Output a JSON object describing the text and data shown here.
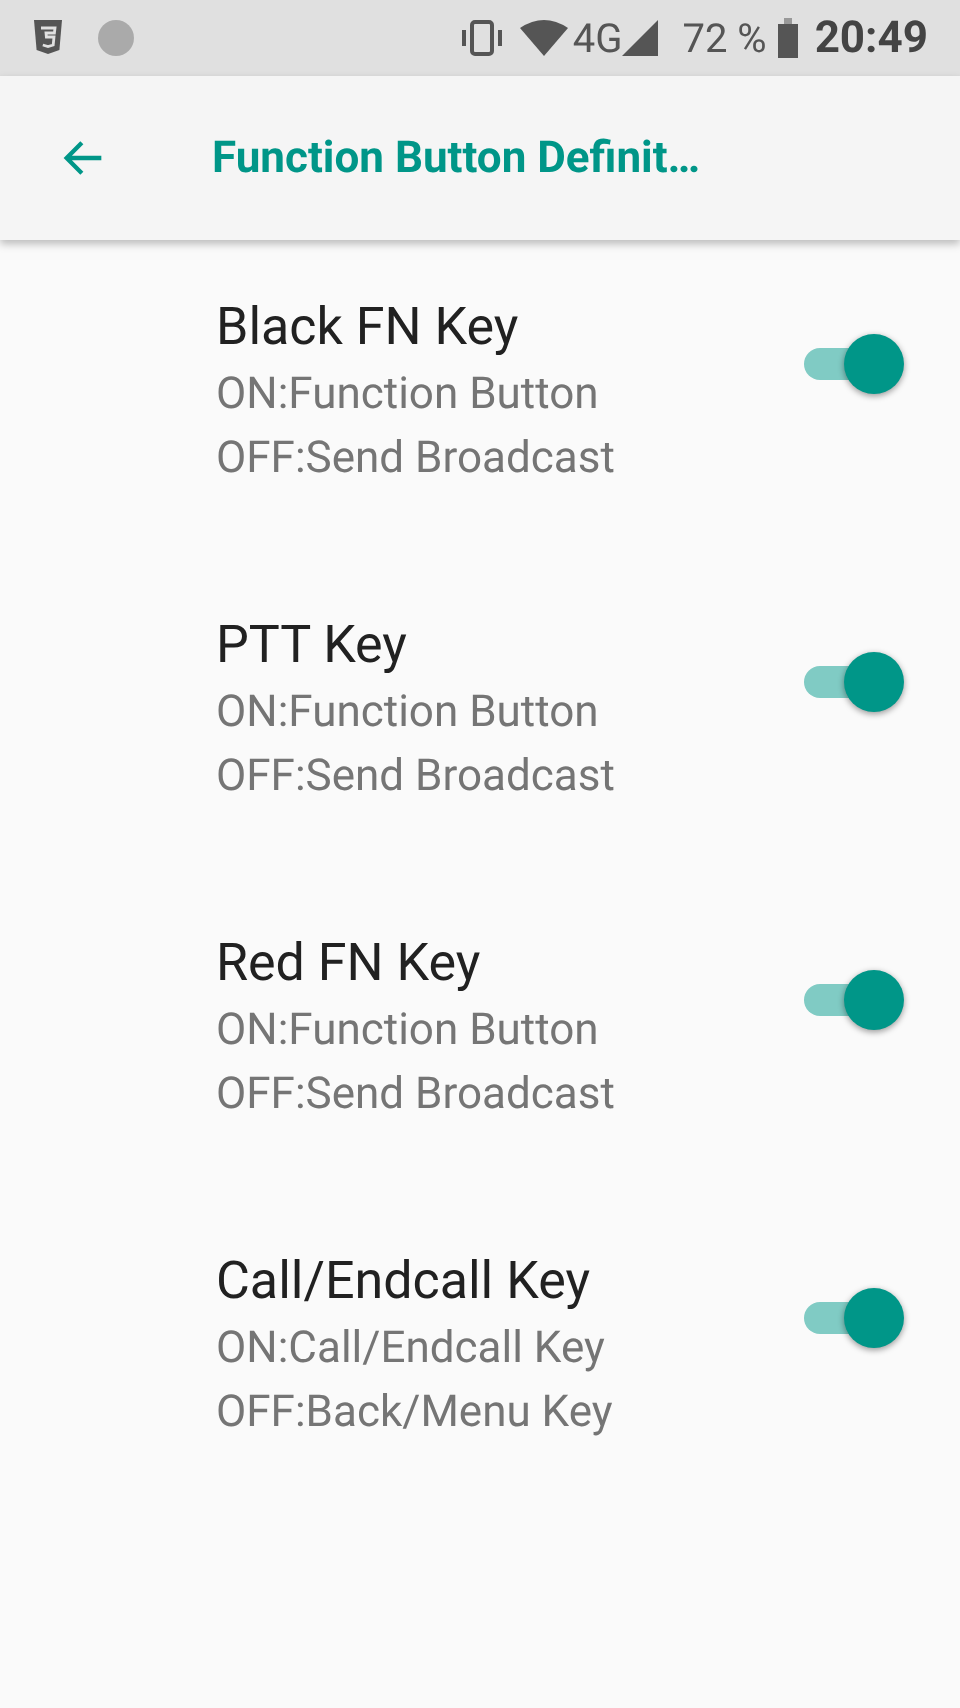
{
  "status_bar": {
    "network": "4G",
    "battery": "72 %",
    "time": "20:49"
  },
  "app_bar": {
    "title": "Function Button Definit…"
  },
  "settings": [
    {
      "title": "Black FN Key",
      "on_text": "ON:Function Button",
      "off_text": "OFF:Send Broadcast",
      "on": true
    },
    {
      "title": "PTT Key",
      "on_text": "ON:Function Button",
      "off_text": "OFF:Send Broadcast",
      "on": true
    },
    {
      "title": "Red FN Key",
      "on_text": "ON:Function Button",
      "off_text": "OFF:Send Broadcast",
      "on": true
    },
    {
      "title": "Call/Endcall Key",
      "on_text": "ON:Call/Endcall Key",
      "off_text": "OFF:Back/Menu Key",
      "on": true
    }
  ]
}
